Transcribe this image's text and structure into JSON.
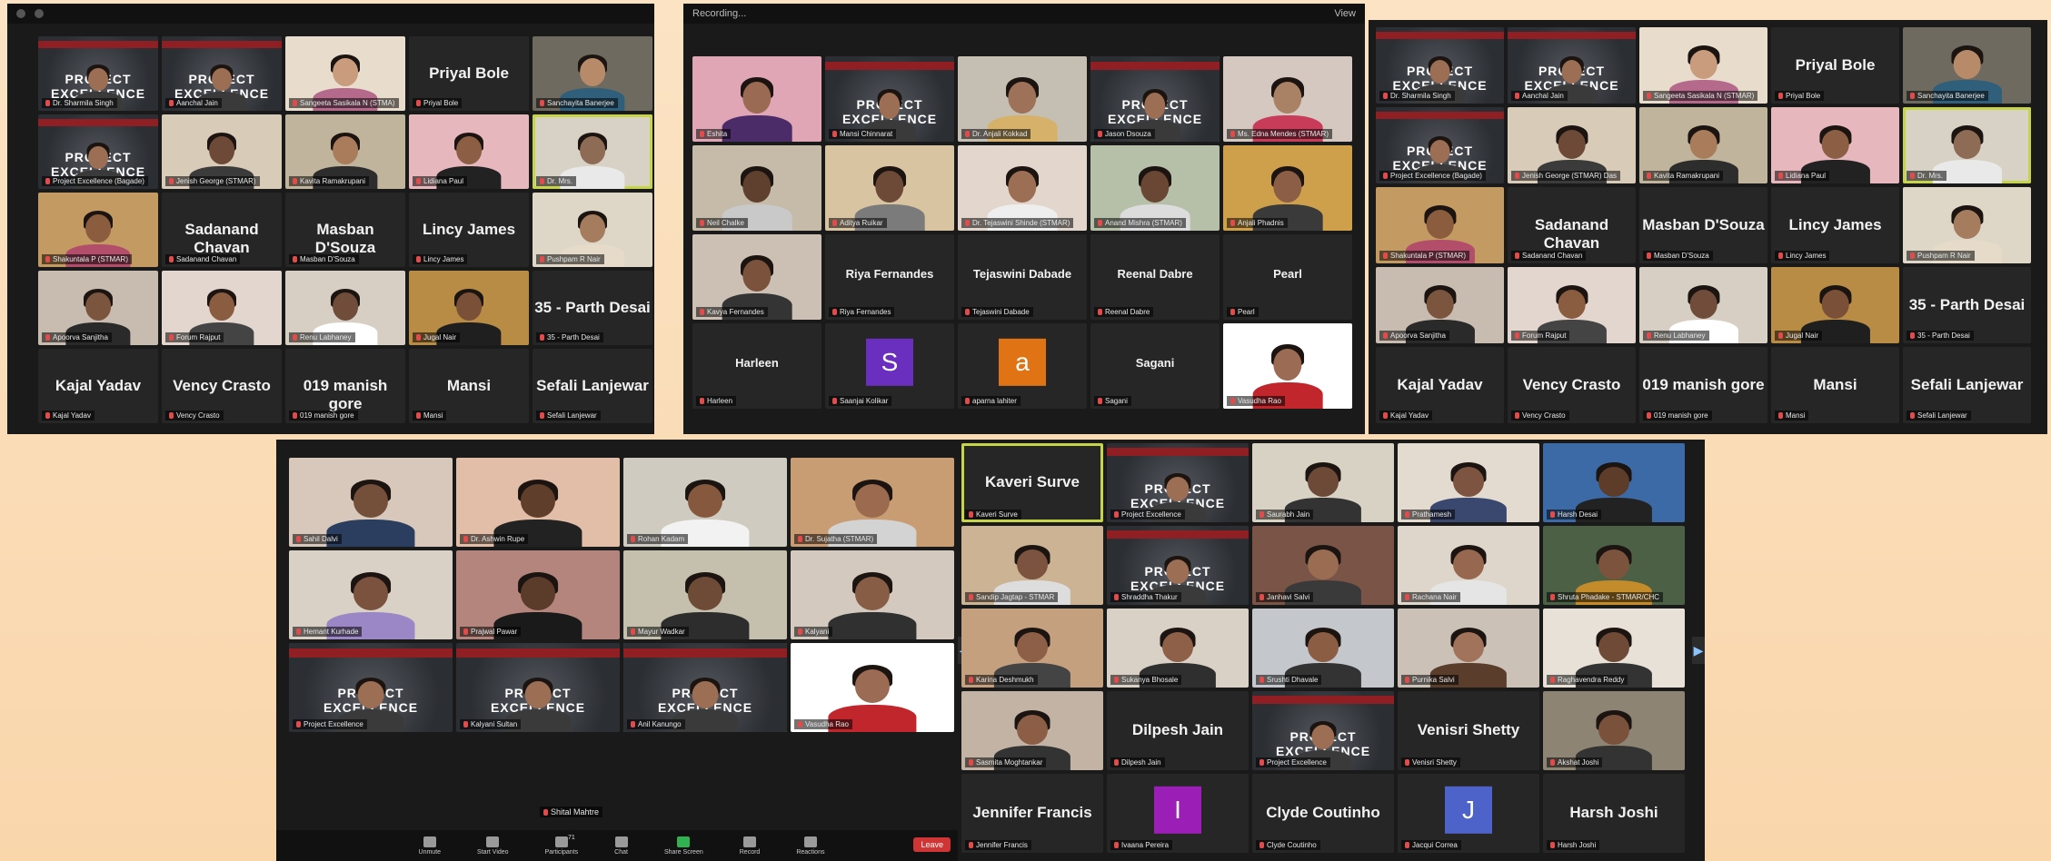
{
  "topbar": {
    "recording_label": "Recording...",
    "view_label": "View"
  },
  "panel1": {
    "tiles": [
      {
        "label": "Dr. Sharmila Singh",
        "kind": "poster"
      },
      {
        "label": "Aanchal Jain",
        "kind": "poster"
      },
      {
        "label": "Sangeeta Sasikala N (STMA)",
        "kind": "person",
        "skin": "#c99c7d",
        "bg": "#e8dccd",
        "shirt": "#b56a8c"
      },
      {
        "label": "Priyal Bole",
        "kind": "name",
        "name": "Priyal Bole"
      },
      {
        "label": "Sanchayita Banerjee",
        "kind": "person",
        "skin": "#b78a6a",
        "bg": "#6e6a60",
        "shirt": "#2f5f7a"
      },
      {
        "label": "Project Excellence (Bagade)",
        "kind": "poster"
      },
      {
        "label": "Jenish George (STMAR)",
        "kind": "person",
        "skin": "#6c4a37",
        "bg": "#d8cbb8",
        "shirt": "#3b3b3b"
      },
      {
        "label": "Kavita Ramakrupani",
        "kind": "person",
        "skin": "#a97c5c",
        "bg": "#c0b49c",
        "shirt": "#2d2d2d"
      },
      {
        "label": "Lidiana Paul",
        "kind": "person",
        "skin": "#8c5f45",
        "bg": "#e7b7be",
        "shirt": "#222"
      },
      {
        "label": "Dr. Mrs.",
        "kind": "person",
        "skin": "#8e6b54",
        "bg": "#d8d2c6",
        "shirt": "#e9e9e9",
        "active": true
      },
      {
        "label": "Shakuntala P (STMAR)",
        "kind": "person",
        "skin": "#8b5d3e",
        "bg": "#c49a63",
        "shirt": "#b34e6a"
      },
      {
        "label": "Sadanand Chavan",
        "kind": "name",
        "name": "Sadanand Chavan"
      },
      {
        "label": "Masban D'Souza",
        "kind": "name",
        "name": "Masban D'Souza"
      },
      {
        "label": "Lincy James",
        "kind": "name",
        "name": "Lincy James"
      },
      {
        "label": "Pushpam R Nair",
        "kind": "person",
        "skin": "#a57c5d",
        "bg": "#ded6c7",
        "shirt": "#e5dbc8"
      },
      {
        "label": "Apoorva Sanjitha",
        "kind": "person",
        "skin": "#7b553e",
        "bg": "#c8bbb0",
        "shirt": "#2a2a2a"
      },
      {
        "label": "Forum Rajput",
        "kind": "person",
        "skin": "#8a5c40",
        "bg": "#e2d6ce",
        "shirt": "#444"
      },
      {
        "label": "Renu Labhaney",
        "kind": "person",
        "skin": "#6f4d3a",
        "bg": "#d7cfc4",
        "shirt": "#fff"
      },
      {
        "label": "Jugal Nair",
        "kind": "person",
        "skin": "#7a5038",
        "bg": "#b88c45",
        "shirt": "#1f1f1f"
      },
      {
        "label": "35 - Parth Desai",
        "kind": "name",
        "name": "35 - Parth Desai"
      },
      {
        "label": "Kajal Yadav",
        "kind": "name",
        "name": "Kajal Yadav"
      },
      {
        "label": "Vency Crasto",
        "kind": "name",
        "name": "Vency Crasto"
      },
      {
        "label": "019 manish gore",
        "kind": "name",
        "name": "019 manish gore"
      },
      {
        "label": "Mansi",
        "kind": "name",
        "name": "Mansi"
      },
      {
        "label": "Sefali Lanjewar",
        "kind": "name",
        "name": "Sefali Lanjewar"
      }
    ]
  },
  "panel2": {
    "tiles": [
      {
        "label": "Eshita",
        "kind": "person",
        "skin": "#9a6a52",
        "bg": "#e0a6b6",
        "shirt": "#4b2c68"
      },
      {
        "label": "Mansi Chinnarat",
        "kind": "poster"
      },
      {
        "label": "Dr. Anjali Kokkad",
        "kind": "person",
        "skin": "#9e7258",
        "bg": "#c5bfb3",
        "shirt": "#d6b16a"
      },
      {
        "label": "Jason Dsouza",
        "kind": "poster",
        "active": true
      },
      {
        "label": "Ms. Edna Mendes (STMAR)",
        "kind": "person",
        "skin": "#a98164",
        "bg": "#d4c8c0",
        "shirt": "#c83c5a"
      },
      {
        "label": "Neil Chalke",
        "kind": "person",
        "skin": "#5f3f2e",
        "bg": "#c6baa9",
        "shirt": "#c9c9c9"
      },
      {
        "label": "Aditya Ruikar",
        "kind": "person",
        "skin": "#6d4a37",
        "bg": "#d9c4a2",
        "shirt": "#7b7b7b"
      },
      {
        "label": "Dr. Tejaswini Shinde (STMAR)",
        "kind": "person",
        "skin": "#9c6e53",
        "bg": "#e3d7cd",
        "shirt": "#eee"
      },
      {
        "label": "Anand Mishra (STMAR)",
        "kind": "person",
        "skin": "#6a4634",
        "bg": "#b6c0a8",
        "shirt": "#dcdcdc"
      },
      {
        "label": "Anjali Phadnis",
        "kind": "person",
        "skin": "#8c5e46",
        "bg": "#cfa04c",
        "shirt": "#3a3a3a"
      },
      {
        "label": "Kavya Fernandes",
        "kind": "person",
        "skin": "#7b533d",
        "bg": "#ccc0b4",
        "shirt": "#343434"
      },
      {
        "label": "Riya Fernandes",
        "kind": "name",
        "name": "Riya Fernandes"
      },
      {
        "label": "Tejaswini Dabade",
        "kind": "name",
        "name": "Tejaswini Dabade"
      },
      {
        "label": "Reenal Dabre",
        "kind": "name",
        "name": "Reenal Dabre"
      },
      {
        "label": "Pearl",
        "kind": "name",
        "name": "Pearl"
      },
      {
        "label": "Harleen",
        "kind": "name",
        "name": "Harleen"
      },
      {
        "label": "Saanjai Kolikar",
        "kind": "avatar",
        "letter": "S",
        "color": "#6a2fbf"
      },
      {
        "label": "aparna lahiter",
        "kind": "avatar",
        "letter": "a",
        "color": "#e07414"
      },
      {
        "label": "Sagani",
        "kind": "name",
        "name": "Sagani"
      },
      {
        "label": "Vasudha Rao",
        "kind": "person",
        "skin": "#9c6b53",
        "bg": "#fff",
        "shirt": "#c2262d"
      }
    ]
  },
  "panel3": {
    "tiles": [
      {
        "label": "Dr. Sharmila Singh",
        "kind": "poster"
      },
      {
        "label": "Aanchal Jain",
        "kind": "poster"
      },
      {
        "label": "Sangeeta Sasikala N (STMAR)",
        "kind": "person",
        "skin": "#c99c7d",
        "bg": "#e8dccd",
        "shirt": "#b56a8c"
      },
      {
        "label": "Priyal Bole",
        "kind": "name",
        "name": "Priyal Bole"
      },
      {
        "label": "Sanchayita Banerjee",
        "kind": "person",
        "skin": "#b78a6a",
        "bg": "#6e6a60",
        "shirt": "#2f5f7a"
      },
      {
        "label": "Project Excellence (Bagade)",
        "kind": "poster"
      },
      {
        "label": "Jenish George (STMAR) Das",
        "kind": "person",
        "skin": "#6c4a37",
        "bg": "#d8cbb8",
        "shirt": "#3b3b3b"
      },
      {
        "label": "Kavita Ramakrupani",
        "kind": "person",
        "skin": "#a97c5c",
        "bg": "#c0b49c",
        "shirt": "#2d2d2d"
      },
      {
        "label": "Lidiana Paul",
        "kind": "person",
        "skin": "#8c5f45",
        "bg": "#e7b7be",
        "shirt": "#222"
      },
      {
        "label": "Dr. Mrs.",
        "kind": "person",
        "skin": "#8e6b54",
        "bg": "#d8d2c6",
        "shirt": "#e9e9e9",
        "active": true
      },
      {
        "label": "Shakuntala P (STMAR)",
        "kind": "person",
        "skin": "#8b5d3e",
        "bg": "#c49a63",
        "shirt": "#b34e6a"
      },
      {
        "label": "Sadanand Chavan",
        "kind": "name",
        "name": "Sadanand Chavan"
      },
      {
        "label": "Masban D'Souza",
        "kind": "name",
        "name": "Masban D'Souza"
      },
      {
        "label": "Lincy James",
        "kind": "name",
        "name": "Lincy James"
      },
      {
        "label": "Pushpam R Nair",
        "kind": "person",
        "skin": "#a57c5d",
        "bg": "#ded6c7",
        "shirt": "#e5dbc8"
      },
      {
        "label": "Apoorva Sanjitha",
        "kind": "person",
        "skin": "#7b553e",
        "bg": "#c8bbb0",
        "shirt": "#2a2a2a"
      },
      {
        "label": "Forum Rajput",
        "kind": "person",
        "skin": "#8a5c40",
        "bg": "#e2d6ce",
        "shirt": "#444"
      },
      {
        "label": "Renu Labhaney",
        "kind": "person",
        "skin": "#6f4d3a",
        "bg": "#d7cfc4",
        "shirt": "#fff"
      },
      {
        "label": "Jugal Nair",
        "kind": "person",
        "skin": "#7a5038",
        "bg": "#b88c45",
        "shirt": "#1f1f1f"
      },
      {
        "label": "35 - Parth Desai",
        "kind": "name",
        "name": "35 - Parth Desai"
      },
      {
        "label": "Kajal Yadav",
        "kind": "name",
        "name": "Kajal Yadav"
      },
      {
        "label": "Vency Crasto",
        "kind": "name",
        "name": "Vency Crasto"
      },
      {
        "label": "019 manish gore",
        "kind": "name",
        "name": "019 manish gore"
      },
      {
        "label": "Mansi",
        "kind": "name",
        "name": "Mansi"
      },
      {
        "label": "Sefali Lanjewar",
        "kind": "name",
        "name": "Sefali Lanjewar"
      }
    ]
  },
  "panel4": {
    "tiles": [
      {
        "label": "Sahil Dalvi",
        "kind": "person",
        "skin": "#74503b",
        "bg": "#d8c8bb",
        "shirt": "#2c3e5f"
      },
      {
        "label": "Dr. Ashwin Rupe",
        "kind": "person",
        "skin": "#5f3f2c",
        "bg": "#e2bda7",
        "shirt": "#222"
      },
      {
        "label": "Rohan Kadam",
        "kind": "person",
        "skin": "#86593f",
        "bg": "#cfcbc0",
        "shirt": "#f2f2f2"
      },
      {
        "label": "Dr. Sujatha (STMAR)",
        "kind": "person",
        "skin": "#9b6a4f",
        "bg": "#c99d73",
        "shirt": "#d3d3d3"
      },
      {
        "label": "Hemant Kurhade",
        "kind": "person",
        "skin": "#7a523d",
        "bg": "#d9d1c5",
        "shirt": "#9b86c6"
      },
      {
        "label": "Prajwal Pawar",
        "kind": "person",
        "skin": "#5b3b2a",
        "bg": "#b4857c",
        "shirt": "#1a1a1a"
      },
      {
        "label": "Mayur Wadkar",
        "kind": "person",
        "skin": "#6e4b37",
        "bg": "#c4c0ad",
        "shirt": "#2d2d2d"
      },
      {
        "label": "Kalyani",
        "kind": "person",
        "skin": "#885d45",
        "bg": "#d3c9bf",
        "shirt": "#303030"
      },
      {
        "label": "Project Excellence",
        "kind": "poster"
      },
      {
        "label": "Kalyani Sultan",
        "kind": "poster"
      },
      {
        "label": "Anil Kanungo",
        "kind": "poster",
        "active": true
      },
      {
        "label": "Vasudha Rao",
        "kind": "person",
        "skin": "#9c6b53",
        "bg": "#fff",
        "shirt": "#c2262d"
      }
    ],
    "extra_label": "Shital Mahtre",
    "controls": [
      "Unmute",
      "Start Video",
      "Participants",
      "Chat",
      "Share Screen",
      "Record",
      "Reactions"
    ],
    "participants_count": "71",
    "leave_label": "Leave"
  },
  "panel5": {
    "tiles": [
      {
        "label": "Kaveri Surve",
        "kind": "name",
        "name": "Kaveri Surve",
        "active": true
      },
      {
        "label": "Project Excellence",
        "kind": "poster"
      },
      {
        "label": "Saurabh Jain",
        "kind": "person",
        "skin": "#6d4a37",
        "bg": "#d8d2c4",
        "shirt": "#333"
      },
      {
        "label": "Prathamesh",
        "kind": "person",
        "skin": "#7d5440",
        "bg": "#e3dad0",
        "shirt": "#3a4870"
      },
      {
        "label": "Harsh Desai",
        "kind": "person",
        "skin": "#5e3c2a",
        "bg": "#3b6aa7",
        "shirt": "#222"
      },
      {
        "label": "Sandip Jagtap - STMAR",
        "kind": "person",
        "skin": "#7b533e",
        "bg": "#ccb394",
        "shirt": "#ddd"
      },
      {
        "label": "Shraddha Thakur",
        "kind": "poster"
      },
      {
        "label": "Janhavi Salvi",
        "kind": "person",
        "skin": "#9a6c52",
        "bg": "#7a5446",
        "shirt": "#3a3a3a"
      },
      {
        "label": "Rachana Nair",
        "kind": "person",
        "skin": "#97684f",
        "bg": "#dfd6cb",
        "shirt": "#e5e5e5"
      },
      {
        "label": "Shruta Phadake - STMAR/CHC",
        "kind": "person",
        "skin": "#7c533d",
        "bg": "#4c6046",
        "shirt": "#c38b2a"
      },
      {
        "label": "Karina Deshmukh",
        "kind": "person",
        "skin": "#8c5f46",
        "bg": "#c5a07f",
        "shirt": "#444"
      },
      {
        "label": "Sukanya Bhosale",
        "kind": "person",
        "skin": "#8e6048",
        "bg": "#d9d0c6",
        "shirt": "#2f2f2f"
      },
      {
        "label": "Srushti Dhavale",
        "kind": "person",
        "skin": "#8b5e44",
        "bg": "#c4c7cb",
        "shirt": "#333"
      },
      {
        "label": "Purnika Salvi",
        "kind": "person",
        "skin": "#a1735a",
        "bg": "#cbc1b6",
        "shirt": "#5a3d2b"
      },
      {
        "label": "Raghavendra Reddy",
        "kind": "person",
        "skin": "#6f4b37",
        "bg": "#e7e1d7",
        "shirt": "#333"
      },
      {
        "label": "Sasmita Moghtankar",
        "kind": "person",
        "skin": "#8c5e45",
        "bg": "#c2b3a5",
        "shirt": "#333"
      },
      {
        "label": "Dilpesh Jain",
        "kind": "name",
        "name": "Dilpesh Jain"
      },
      {
        "label": "Project Excellence",
        "kind": "poster"
      },
      {
        "label": "Venisri Shetty",
        "kind": "name",
        "name": "Venisri Shetty"
      },
      {
        "label": "Akshat Joshi",
        "kind": "person",
        "skin": "#7a513b",
        "bg": "#8d8474",
        "shirt": "#333"
      },
      {
        "label": "Jennifer Francis",
        "kind": "name",
        "name": "Jennifer Francis"
      },
      {
        "label": "Ivaana Pereira",
        "kind": "avatar",
        "letter": "I",
        "color": "#9b1fb6"
      },
      {
        "label": "Clyde Coutinho",
        "kind": "name",
        "name": "Clyde Coutinho"
      },
      {
        "label": "Jacqui Correa",
        "kind": "avatar",
        "letter": "J",
        "color": "#4e63c9"
      },
      {
        "label": "Harsh Joshi",
        "kind": "name",
        "name": "Harsh Joshi"
      }
    ]
  },
  "poster_text": "PROJECT EXCELLENCE"
}
